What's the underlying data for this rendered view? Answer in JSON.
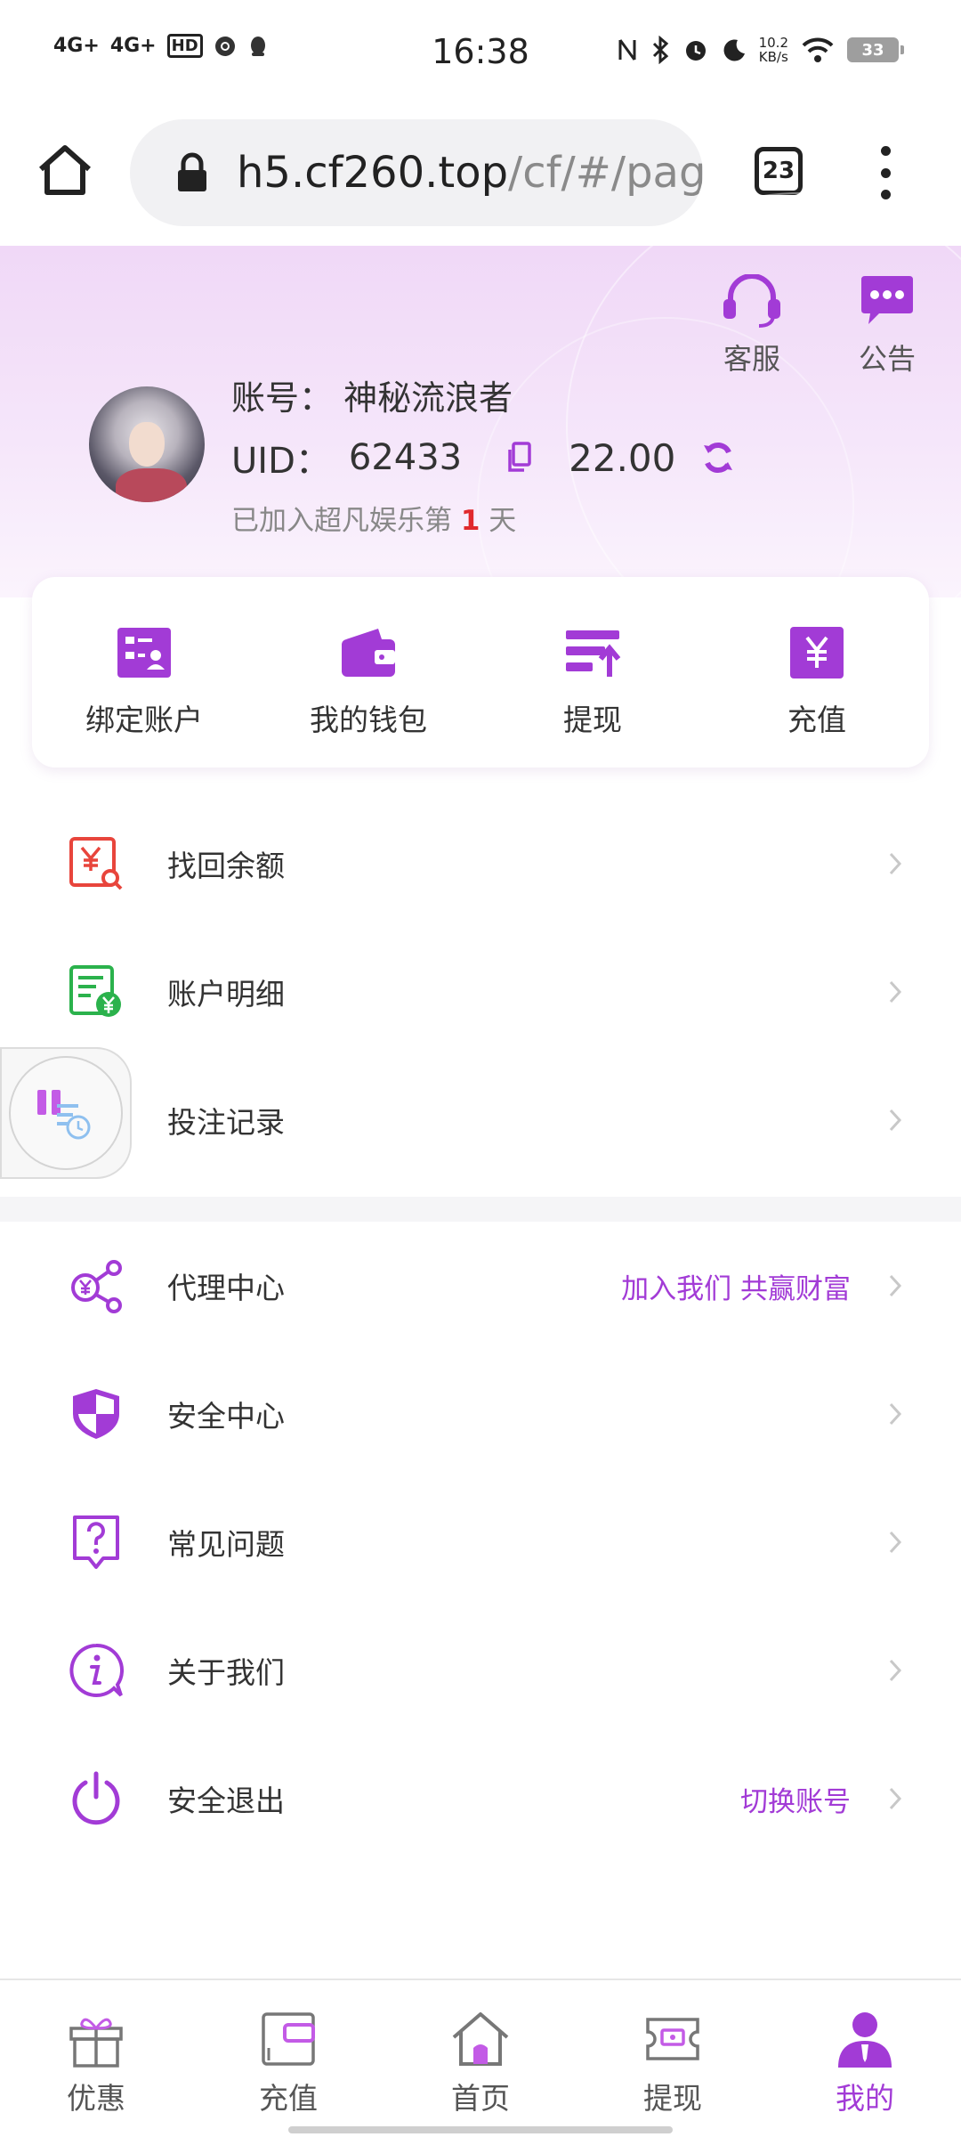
{
  "status_bar": {
    "network_1": "4G+",
    "network_2": "4G+",
    "hd": "HD",
    "time": "16:38",
    "speed_value": "10.2",
    "speed_unit": "KB/s",
    "battery": "33"
  },
  "browser": {
    "url_host": "h5.cf260.top",
    "url_path": "/cf/#/pag",
    "tab_count": "23"
  },
  "header": {
    "service_label": "客服",
    "notice_label": "公告",
    "account_label": "账号：",
    "account_name": "神秘流浪者",
    "uid_label": "UID：",
    "uid_value": "62433",
    "balance": "22.00",
    "days_prefix": "已加入超凡娱乐第",
    "days_count": "1",
    "days_suffix": "天"
  },
  "actions": [
    {
      "label": "绑定账户",
      "icon": "bind-account-icon"
    },
    {
      "label": "我的钱包",
      "icon": "wallet-icon"
    },
    {
      "label": "提现",
      "icon": "withdraw-icon"
    },
    {
      "label": "充值",
      "icon": "recharge-icon"
    }
  ],
  "menu_group_1": [
    {
      "label": "找回余额",
      "icon": "recover-balance-icon"
    },
    {
      "label": "账户明细",
      "icon": "account-detail-icon"
    },
    {
      "label": "投注记录",
      "icon": "bet-record-icon"
    }
  ],
  "menu_group_2": [
    {
      "label": "代理中心",
      "extra": "加入我们 共赢财富",
      "icon": "agent-center-icon"
    },
    {
      "label": "安全中心",
      "icon": "security-shield-icon"
    },
    {
      "label": "常见问题",
      "icon": "faq-icon"
    },
    {
      "label": "关于我们",
      "icon": "info-icon"
    },
    {
      "label": "安全退出",
      "extra": "切换账号",
      "icon": "power-icon"
    }
  ],
  "tab_bar": [
    {
      "label": "优惠",
      "icon": "gift-icon",
      "active": false
    },
    {
      "label": "充值",
      "icon": "wallet-card-icon",
      "active": false
    },
    {
      "label": "首页",
      "icon": "home-icon",
      "active": false
    },
    {
      "label": "提现",
      "icon": "cash-ticket-icon",
      "active": false
    },
    {
      "label": "我的",
      "icon": "profile-icon",
      "active": true
    }
  ],
  "colors": {
    "accent": "#a23bd6",
    "danger": "#e0292c",
    "green": "#2bb24c",
    "red_icon": "#e8453c"
  }
}
